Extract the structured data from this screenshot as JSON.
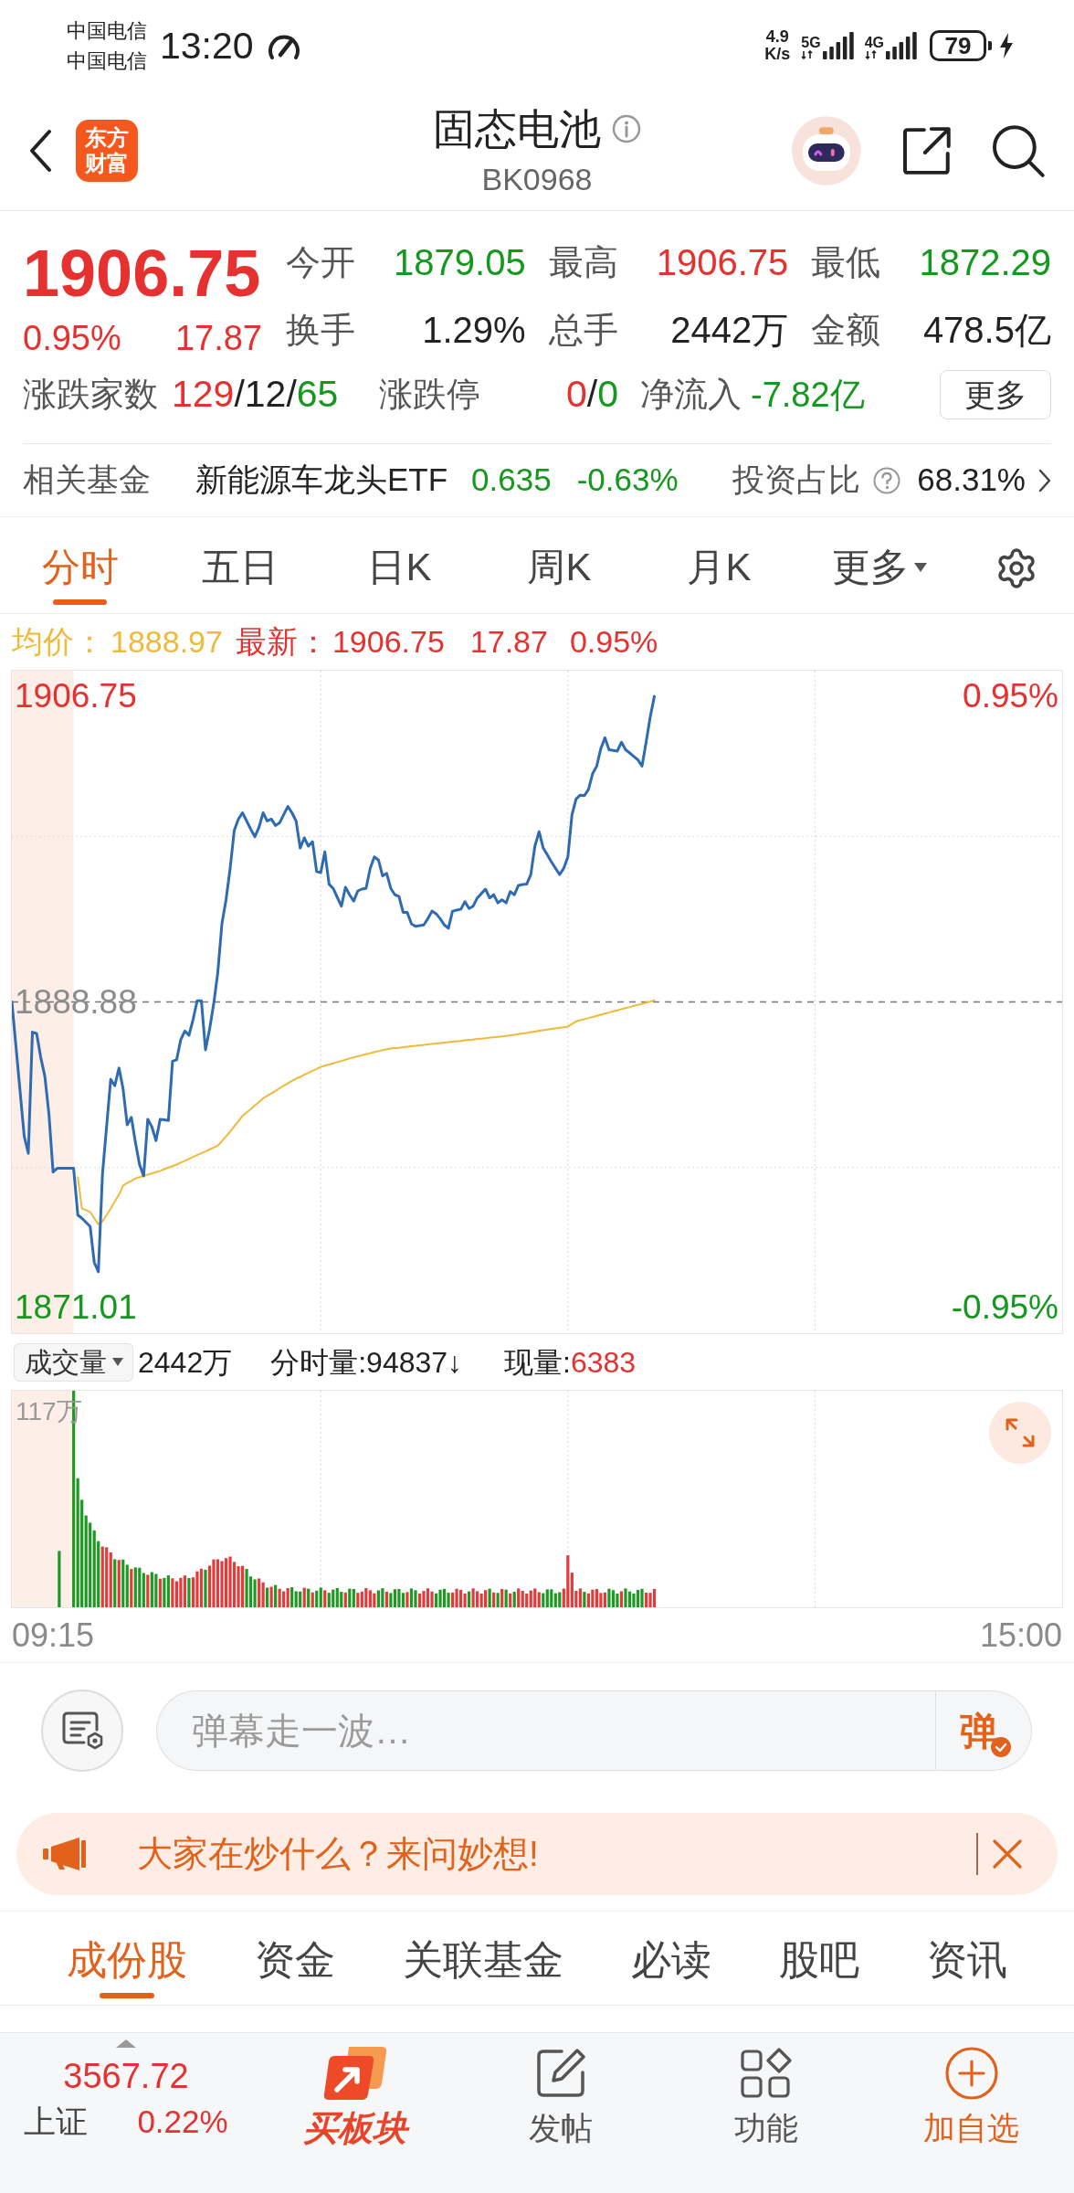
{
  "status_bar": {
    "carriers": [
      "中国电信",
      "中国电信"
    ],
    "time": "13:20",
    "net_speed": [
      "4.9",
      "K/s"
    ],
    "network_types": [
      "5G",
      "4G"
    ],
    "battery": "79"
  },
  "header": {
    "logo_text": [
      "东方",
      "财富"
    ],
    "title": "固态电池",
    "code": "BK0968"
  },
  "quote": {
    "price": "1906.75",
    "change_pct": "0.95%",
    "change": "17.87",
    "rising": true,
    "stats": [
      {
        "label": "今开",
        "value": "1879.05",
        "color": "#14991e"
      },
      {
        "label": "最高",
        "value": "1906.75",
        "color": "#e5312f"
      },
      {
        "label": "最低",
        "value": "1872.29",
        "color": "#14991e"
      },
      {
        "label": "换手",
        "value": "1.29%",
        "color": "#222222"
      },
      {
        "label": "总手",
        "value": "2442万",
        "color": "#222222"
      },
      {
        "label": "金额",
        "value": "478.5亿",
        "color": "#222222"
      }
    ],
    "breadth": {
      "label": "涨跌家数",
      "parts": [
        {
          "text": "129",
          "color": "#e5312f"
        },
        {
          "text": "/12/",
          "color": "#222222"
        },
        {
          "text": "65",
          "color": "#14991e"
        }
      ]
    },
    "limits": {
      "label": "涨跌停",
      "parts": [
        {
          "text": "0",
          "color": "#e5312f"
        },
        {
          "text": "/",
          "color": "#222222"
        },
        {
          "text": "0",
          "color": "#14991e"
        }
      ]
    },
    "net_inflow": {
      "label": "净流入",
      "value": "-7.82亿",
      "rising": false
    },
    "more_button": "更多"
  },
  "related_fund": {
    "label": "相关基金",
    "name": "新能源车龙头ETF",
    "price": "0.635",
    "change_pct": "-0.63%",
    "rising": false,
    "ratio_label": "投资占比",
    "ratio": "68.31%"
  },
  "chart_tabs": [
    {
      "label": "分时",
      "selected": true,
      "kind": "tab"
    },
    {
      "label": "五日",
      "selected": false,
      "kind": "tab"
    },
    {
      "label": "日K",
      "selected": false,
      "kind": "tab"
    },
    {
      "label": "周K",
      "selected": false,
      "kind": "tab"
    },
    {
      "label": "月K",
      "selected": false,
      "kind": "tab"
    },
    {
      "label": "更多",
      "selected": false,
      "kind": "menu"
    }
  ],
  "price_chart": {
    "legend": {
      "average": "1888.97",
      "latest_label": "最新：",
      "latest": "1906.75",
      "change": "17.87",
      "change_pct": "0.95%",
      "rising": true
    },
    "right_labels": [
      {
        "text": "0.95%",
        "color": "#e5312f"
      },
      {
        "text": "-0.95%",
        "color": "#14991e"
      }
    ],
    "chart_data": {
      "type": "line",
      "categories": [
        null,
        null,
        null,
        null,
        null,
        null,
        null,
        null,
        null,
        null,
        null,
        null,
        null,
        null,
        null,
        null,
        null,
        null,
        null,
        null,
        null,
        null,
        null,
        null,
        null,
        null,
        null,
        null,
        null,
        null,
        null,
        null,
        null,
        null,
        null,
        null,
        null,
        null,
        null,
        null,
        null,
        null,
        null,
        null,
        null,
        null,
        null,
        null,
        null,
        null,
        null,
        null,
        null,
        null,
        null,
        null,
        null,
        null,
        null,
        null,
        null,
        null,
        null,
        null,
        null,
        null,
        null,
        null,
        null,
        null,
        null,
        null,
        null,
        null,
        null,
        null,
        null,
        null,
        null,
        null,
        null,
        null,
        null,
        null,
        null,
        null,
        null,
        null,
        null,
        null,
        null,
        null,
        null,
        null,
        null,
        null,
        null,
        null,
        null,
        null,
        null,
        null,
        null,
        null,
        null,
        null,
        null,
        null,
        null,
        null,
        null,
        null,
        null,
        null,
        null,
        null,
        null,
        null,
        null,
        null,
        null,
        null,
        null,
        null,
        null,
        null,
        null,
        null,
        null,
        null,
        null,
        null,
        null,
        null,
        null,
        null,
        null,
        null,
        null,
        null,
        null,
        null,
        null,
        null,
        null,
        null,
        null,
        null,
        null,
        null,
        null,
        null,
        null,
        null,
        null,
        null,
        null,
        null,
        null,
        null,
        null,
        null,
        null,
        null,
        null,
        null,
        null,
        null,
        null,
        null,
        null,
        null,
        null,
        null,
        null,
        null,
        null,
        null,
        null,
        null,
        null,
        null,
        null,
        null,
        null,
        null,
        null,
        null,
        null,
        null,
        null,
        null,
        null,
        null,
        null,
        null,
        null,
        null,
        null,
        null,
        null,
        null,
        null,
        null,
        null,
        null,
        null,
        null,
        null,
        null,
        null,
        null,
        null,
        null,
        null,
        null,
        null,
        null,
        null,
        null,
        null,
        null,
        null,
        null,
        null,
        null,
        null,
        null,
        null,
        null,
        null,
        null,
        null,
        null,
        null,
        null,
        null,
        null,
        null,
        null,
        null,
        null,
        null,
        null,
        null,
        null,
        null,
        null,
        null,
        null,
        null,
        null,
        null,
        null,
        null,
        null
      ],
      "series": [
        {
          "name": "均价：",
          "color": "#efb93a",
          "values": [
            null,
            null,
            null,
            null,
            null,
            null,
            null,
            null,
            null,
            null,
            null,
            null,
            null,
            null,
            null,
            null,
            1878.63,
            1876.79,
            1876.7,
            1876.6,
            1876.24,
            1875.87,
            1876.05,
            1876.42,
            1876.79,
            1877.2,
            1877.6,
            1878.15,
            1878.29,
            1878.42,
            1878.56,
            1878.63,
            1878.71,
            1878.78,
            1878.85,
            1878.93,
            1879.0,
            1879.1,
            1879.19,
            1879.28,
            1879.37,
            1879.48,
            1879.59,
            1879.7,
            1879.81,
            1879.92,
            1880.03,
            1880.14,
            1880.25,
            1880.36,
            1880.47,
            1880.74,
            1881.02,
            1881.29,
            1881.6,
            1881.9,
            1882.21,
            1882.42,
            1882.62,
            1882.83,
            1883.03,
            1883.24,
            1883.39,
            1883.53,
            1883.68,
            1883.83,
            1883.98,
            1884.12,
            1884.27,
            1884.39,
            1884.5,
            1884.62,
            1884.73,
            1884.85,
            1884.96,
            1885.08,
            1885.15,
            1885.22,
            1885.29,
            1885.36,
            1885.43,
            1885.5,
            1885.57,
            1885.64,
            1885.7,
            1885.76,
            1885.82,
            1885.88,
            1885.94,
            1886.0,
            1886.06,
            1886.12,
            1886.15,
            1886.18,
            1886.2,
            1886.23,
            1886.26,
            1886.29,
            1886.31,
            1886.34,
            1886.37,
            1886.4,
            1886.42,
            1886.45,
            1886.47,
            1886.5,
            1886.53,
            1886.55,
            1886.58,
            1886.6,
            1886.63,
            1886.66,
            1886.68,
            1886.71,
            1886.73,
            1886.76,
            1886.79,
            1886.81,
            1886.84,
            1886.86,
            1886.89,
            1886.93,
            1886.96,
            1887.0,
            1887.04,
            1887.07,
            1887.11,
            1887.15,
            1887.19,
            1887.22,
            1887.26,
            1887.3,
            1887.33,
            1887.37,
            1887.4,
            1887.44,
            1887.59,
            1887.74,
            1887.81,
            1887.87,
            1887.94,
            1888.0,
            1888.07,
            1888.13,
            1888.2,
            1888.26,
            1888.33,
            1888.39,
            1888.46,
            1888.52,
            1888.58,
            1888.65,
            1888.71,
            1888.77,
            1888.84,
            1888.9,
            1888.97,
            null,
            null,
            null,
            null,
            null,
            null,
            null,
            null,
            null,
            null,
            null,
            null,
            null,
            null,
            null,
            null,
            null,
            null,
            null,
            null,
            null,
            null,
            null,
            null,
            null,
            null,
            null,
            null,
            null,
            null,
            null,
            null,
            null,
            null,
            null,
            null,
            null,
            null,
            null,
            null,
            null,
            null,
            null,
            null,
            null,
            null,
            null,
            null,
            null,
            null,
            null,
            null,
            null,
            null,
            null,
            null,
            null,
            null,
            null,
            null,
            null,
            null,
            null,
            null,
            null,
            null,
            null,
            null,
            null,
            null,
            null,
            null,
            null,
            null,
            null,
            null,
            null,
            null,
            null,
            null,
            null,
            null,
            null,
            null,
            null,
            null,
            null,
            null,
            null,
            null,
            null,
            null,
            null,
            null,
            null,
            null,
            null,
            null,
            null
          ]
        },
        {
          "color": "#2e6bb3",
          "values": [
            1888.88,
            1886.26,
            1883.65,
            1881.03,
            1880.03,
            1887.11,
            1887.04,
            1885.64,
            1884.53,
            1882.32,
            1878.93,
            1879.15,
            1879.15,
            1879.15,
            1879.15,
            1879.15,
            1876.42,
            1876.23,
            1875.99,
            1875.75,
            1873.65,
            1873.1,
            1878.81,
            1881.58,
            1884.35,
            1883.98,
            1885.01,
            1883.79,
            1881.69,
            1882.13,
            1880.66,
            1879.37,
            1878.7,
            1882.02,
            1881.58,
            1880.77,
            1882.02,
            1881.99,
            1881.95,
            1885.41,
            1885.49,
            1886.67,
            1887.18,
            1886.93,
            1887.85,
            1888.95,
            1888.95,
            1886.08,
            1887.29,
            1888.77,
            1890.61,
            1893.45,
            1894.85,
            1896.7,
            1898.91,
            1899.57,
            1899.94,
            1899.46,
            1898.98,
            1898.54,
            1899.09,
            1899.94,
            1899.46,
            1899.57,
            1899.2,
            1899.35,
            1899.83,
            1900.31,
            1899.94,
            1899.46,
            1897.88,
            1898.47,
            1897.99,
            1898.25,
            1896.51,
            1896.44,
            1897.66,
            1895.77,
            1895.52,
            1895.0,
            1894.48,
            1895.59,
            1895.15,
            1894.78,
            1895.37,
            1895.48,
            1895.52,
            1896.7,
            1897.36,
            1897.18,
            1896.25,
            1896.4,
            1895.52,
            1895.15,
            1895.04,
            1894.12,
            1894.12,
            1893.45,
            1893.3,
            1893.34,
            1893.38,
            1893.75,
            1894.19,
            1894.04,
            1893.75,
            1893.38,
            1893.19,
            1894.19,
            1894.25,
            1894.3,
            1894.74,
            1894.34,
            1894.48,
            1894.96,
            1895.22,
            1895.48,
            1894.96,
            1895.15,
            1894.67,
            1894.85,
            1894.67,
            1895.33,
            1895.15,
            1895.7,
            1895.74,
            1895.77,
            1896.33,
            1897.99,
            1898.84,
            1897.88,
            1897.48,
            1897.07,
            1896.7,
            1896.33,
            1896.7,
            1897.36,
            1899.83,
            1900.75,
            1900.97,
            1900.94,
            1901.31,
            1902.23,
            1902.67,
            1903.7,
            1904.33,
            1903.63,
            1903.59,
            1903.55,
            1904.07,
            1903.63,
            1903.44,
            1903.24,
            1903.04,
            1902.67,
            1904.07,
            1905.55,
            1906.75,
            null,
            null,
            null,
            null,
            null,
            null,
            null,
            null,
            null,
            null,
            null,
            null,
            null,
            null,
            null,
            null,
            null,
            null,
            null,
            null,
            null,
            null,
            null,
            null,
            null,
            null,
            null,
            null,
            null,
            null,
            null,
            null,
            null,
            null,
            null,
            null,
            null,
            null,
            null,
            null,
            null,
            null,
            null,
            null,
            null,
            null,
            null,
            null,
            null,
            null,
            null,
            null,
            null,
            null,
            null,
            null,
            null,
            null,
            null,
            null,
            null,
            null,
            null,
            null,
            null,
            null,
            null,
            null,
            null,
            null,
            null,
            null,
            null,
            null,
            null,
            null,
            null,
            null,
            null,
            null,
            null,
            null,
            null,
            null,
            null,
            null,
            null,
            null,
            null,
            null,
            null,
            null,
            null,
            null,
            null,
            null,
            null,
            null,
            null
          ]
        },
        {
          "color": "#777777",
          "line_style": "dashed",
          "values": [
            1888.88,
            1888.88,
            1888.88,
            1888.88,
            1888.88,
            1888.88,
            1888.88,
            1888.88,
            1888.88,
            1888.88,
            1888.88,
            1888.88,
            1888.88,
            1888.88,
            1888.88,
            1888.88,
            1888.88,
            1888.88,
            1888.88,
            1888.88,
            1888.88,
            1888.88,
            1888.88,
            1888.88,
            1888.88,
            1888.88,
            1888.88,
            1888.88,
            1888.88,
            1888.88,
            1888.88,
            1888.88,
            1888.88,
            1888.88,
            1888.88,
            1888.88,
            1888.88,
            1888.88,
            1888.88,
            1888.88,
            1888.88,
            1888.88,
            1888.88,
            1888.88,
            1888.88,
            1888.88,
            1888.88,
            1888.88,
            1888.88,
            1888.88,
            1888.88,
            1888.88,
            1888.88,
            1888.88,
            1888.88,
            1888.88,
            1888.88,
            1888.88,
            1888.88,
            1888.88,
            1888.88,
            1888.88,
            1888.88,
            1888.88,
            1888.88,
            1888.88,
            1888.88,
            1888.88,
            1888.88,
            1888.88,
            1888.88,
            1888.88,
            1888.88,
            1888.88,
            1888.88,
            1888.88,
            1888.88,
            1888.88,
            1888.88,
            1888.88,
            1888.88,
            1888.88,
            1888.88,
            1888.88,
            1888.88,
            1888.88,
            1888.88,
            1888.88,
            1888.88,
            1888.88,
            1888.88,
            1888.88,
            1888.88,
            1888.88,
            1888.88,
            1888.88,
            1888.88,
            1888.88,
            1888.88,
            1888.88,
            1888.88,
            1888.88,
            1888.88,
            1888.88,
            1888.88,
            1888.88,
            1888.88,
            1888.88,
            1888.88,
            1888.88,
            1888.88,
            1888.88,
            1888.88,
            1888.88,
            1888.88,
            1888.88,
            1888.88,
            1888.88,
            1888.88,
            1888.88,
            1888.88,
            1888.88,
            1888.88,
            1888.88,
            1888.88,
            1888.88,
            1888.88,
            1888.88,
            1888.88,
            1888.88,
            1888.88,
            1888.88,
            1888.88,
            1888.88,
            1888.88,
            1888.88,
            1888.88,
            1888.88,
            1888.88,
            1888.88,
            1888.88,
            1888.88,
            1888.88,
            1888.88,
            1888.88,
            1888.88,
            1888.88,
            1888.88,
            1888.88,
            1888.88,
            1888.88,
            1888.88,
            1888.88,
            1888.88,
            1888.88,
            1888.88,
            1888.88,
            1888.88,
            1888.88,
            1888.88,
            1888.88,
            1888.88,
            1888.88,
            1888.88,
            1888.88,
            1888.88,
            1888.88,
            1888.88,
            1888.88,
            1888.88,
            1888.88,
            1888.88,
            1888.88,
            1888.88,
            1888.88,
            1888.88,
            1888.88,
            1888.88,
            1888.88,
            1888.88,
            1888.88,
            1888.88,
            1888.88,
            1888.88,
            1888.88,
            1888.88,
            1888.88,
            1888.88,
            1888.88,
            1888.88,
            1888.88,
            1888.88,
            1888.88,
            1888.88,
            1888.88,
            1888.88,
            1888.88,
            1888.88,
            1888.88,
            1888.88,
            1888.88,
            1888.88,
            1888.88,
            1888.88,
            1888.88,
            1888.88,
            1888.88,
            1888.88,
            1888.88,
            1888.88,
            1888.88,
            1888.88,
            1888.88,
            1888.88,
            1888.88,
            1888.88,
            1888.88,
            1888.88,
            1888.88,
            1888.88,
            1888.88,
            1888.88,
            1888.88,
            1888.88,
            1888.88,
            1888.88,
            1888.88,
            1888.88,
            1888.88,
            1888.88,
            1888.88,
            1888.88,
            1888.88,
            1888.88,
            1888.88,
            1888.88,
            1888.88,
            1888.88,
            1888.88,
            1888.88,
            1888.88,
            1888.88,
            1888.88,
            1888.88,
            1888.88,
            1888.88,
            1888.88,
            1888.88,
            1888.88,
            1888.88,
            1888.88,
            1888.88,
            1888.88,
            1888.88,
            1888.88,
            1888.88
          ]
        }
      ],
      "ylim": [
        1869.51,
        1908.25
      ],
      "yticks": [
        {
          "value": 1871.01,
          "label": "1871.01"
        },
        {
          "value": 1888.88,
          "label": "1888.88"
        },
        {
          "value": 1906.75,
          "label": "1906.75"
        }
      ]
    }
  },
  "volume_bar": {
    "selector": "成交量",
    "total": "2442万",
    "minute_volume": "分时量:94837↓",
    "current_label": "现量:",
    "current": "6383",
    "current_rising": true
  },
  "volume_chart": {
    "max_label": "117万"
  },
  "time_axis": [
    "09:15",
    "15:00"
  ],
  "danmaku": {
    "placeholder": "弹幕走一波…",
    "send": "弹"
  },
  "banner": {
    "text": "大家在炒什么？来问妙想!"
  },
  "bottom_tabs": [
    {
      "label": "成份股",
      "selected": true
    },
    {
      "label": "资金",
      "selected": false
    },
    {
      "label": "关联基金",
      "selected": false
    },
    {
      "label": "必读",
      "selected": false
    },
    {
      "label": "股吧",
      "selected": false
    },
    {
      "label": "资讯",
      "selected": false
    }
  ],
  "bottom_bar": {
    "index": {
      "value": "3567.72",
      "name": "上证",
      "change_pct": "0.22%",
      "rising": true
    },
    "actions": [
      {
        "label": "买板块",
        "kind": "brand"
      },
      {
        "label": "发帖",
        "kind": "post"
      },
      {
        "label": "功能",
        "kind": "grid"
      },
      {
        "label": "加自选",
        "kind": "add"
      }
    ]
  }
}
